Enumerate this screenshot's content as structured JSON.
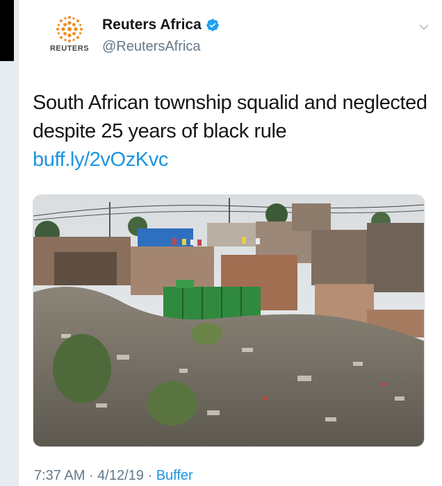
{
  "account": {
    "name": "Reuters Africa",
    "handle": "@ReutersAfrica",
    "logo_text": "REUTERS",
    "verified_icon": "verified-badge-icon"
  },
  "tweet": {
    "text": "South African township squalid and neglected despite 25 years of black rule",
    "link": "buff.ly/2vOzKvc",
    "image_description_icon": "photo"
  },
  "footer": {
    "time": "7:37 AM",
    "separator": " · ",
    "date": "4/12/19",
    "source": "Buffer"
  },
  "colors": {
    "link": "#1b95e0",
    "muted": "#657786",
    "text": "#14171a",
    "reuters_orange": "#f08c1e"
  }
}
